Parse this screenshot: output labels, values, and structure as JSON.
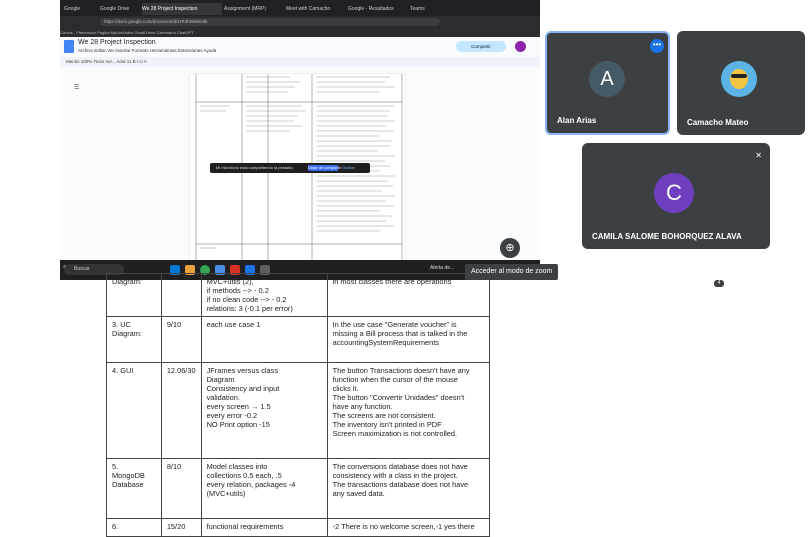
{
  "browser": {
    "tabs": [
      "Google",
      "Google Drive",
      "We 28 Project Inspection",
      "Assignment (MRP)",
      "Meet with Camacho",
      "Google - Resultados",
      "Teams"
    ],
    "url": "https://docs.google.com/document/d/1rR4hWeb/edit",
    "bookmarks": "Cursos - Planeacion  Pagina  MyUniAndes  Gmail  Drive  Calendario  ChatGPT"
  },
  "docs": {
    "title": "We 28 Project Inspection",
    "menu": "Archivo  Editar  Ver  Insertar  Formato  Herramientas  Extensiones  Ayuda",
    "share_label": "Compartir",
    "toolbar": "Menús   100%   Texto nor...   Arial   11   B  I  U  A"
  },
  "notification": {
    "text": "Mi micrófono está compartiendo la pestaña",
    "button": "Dejar de compartir",
    "hide": "Ocultar"
  },
  "taskbar": {
    "search": "Buscar",
    "weather": "Alerta de..."
  },
  "meet": {
    "participants": [
      {
        "name": "Alan Arias",
        "initial": "A",
        "color": "#455a64"
      },
      {
        "name": "Camacho Mateo",
        "initial": "",
        "color": "#3c4043"
      },
      {
        "name": "CAMILA SALOME BOHORQUEZ ALAVA",
        "initial": "C",
        "color": "#6f3fbf"
      }
    ],
    "zoom_tooltip": "Acceder al modo de zoom"
  },
  "grade_table": {
    "rows": [
      {
        "criterion": [
          "Diagram:"
        ],
        "score": "",
        "rubric": [
          "MVC+utils (2),",
          "if methods --> - 0.2",
          "if no clean code --> - 0.2",
          "relations: 3 (-0.1 per error)"
        ],
        "comments": [
          "in most classes there are operations"
        ]
      },
      {
        "criterion": [
          "3. UC",
          "Diagram:"
        ],
        "score": "9/10",
        "rubric": [
          "each use case 1"
        ],
        "comments": [
          "In the use case \"Generate voucher\" is",
          "missing a Bill process that is talked in the",
          "accountingSystemRequirements"
        ]
      },
      {
        "criterion": [
          "4. GUI"
        ],
        "score": "12.06/30",
        "rubric": [
          "JFrames versus class",
          "Diagram",
          "Consistency and input",
          "validation.",
          "every screen → 1.5",
          "every error -0.2",
          "NO Print option -15"
        ],
        "comments": [
          "The button Transactions doesn't have any",
          "function when the cursor of the mouse",
          "clicks it.",
          "The button \"Convertir Unidades\" doesn't",
          "have any function.",
          "The screens are not consistent.",
          "The inventory isn't printed in PDF",
          "Screen maximization is not controlled."
        ]
      },
      {
        "criterion": [
          "5.",
          "MongoDB",
          "Database"
        ],
        "score": "8/10",
        "rubric": [
          "Model classes into",
          "collections 0.5 each, .5",
          "every relation, packages -4",
          "(MVC+utils)"
        ],
        "comments": [
          "The conversions database does not have",
          "consistency with a class in the project.",
          "The transactions database does not have",
          "any saved data."
        ]
      },
      {
        "criterion": [
          "6."
        ],
        "score": "15/20",
        "rubric": [
          "functional requirements"
        ],
        "comments": [
          "-2 There is no welcome screen,-1 yes there"
        ]
      }
    ]
  }
}
